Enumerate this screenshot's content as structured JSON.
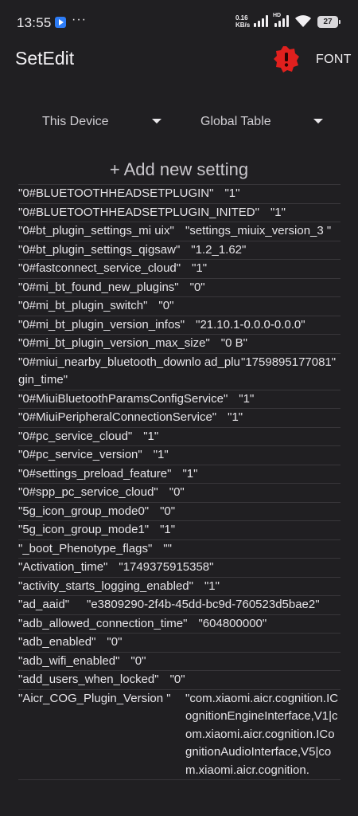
{
  "status_bar": {
    "time": "13:55",
    "more": "···",
    "net_speed_value": "0.16",
    "net_speed_unit": "KB/s",
    "hd": "HD",
    "battery": "27"
  },
  "app_bar": {
    "title": "SetEdit",
    "font_button": "FONT",
    "accent_color": "#e0201e"
  },
  "dropdowns": {
    "device": "This Device",
    "table": "Global Table"
  },
  "add_setting": "+ Add new setting",
  "settings": [
    {
      "key": "\"0#BLUETOOTHHEADSETPLUGIN\"",
      "value": "\"1\""
    },
    {
      "key": "\"0#BLUETOOTHHEADSETPLUGIN_INITED\"",
      "value": "\"1\""
    },
    {
      "key": "\"0#bt_plugin_settings_mi uix\"",
      "value": "\"settings_miuix_version_3 \""
    },
    {
      "key": "\"0#bt_plugin_settings_qigsaw\"",
      "value": "\"1.2_1.62\""
    },
    {
      "key": "\"0#fastconnect_service_cloud\"",
      "value": "\"1\""
    },
    {
      "key": "\"0#mi_bt_found_new_plugins\"",
      "value": "\"0\""
    },
    {
      "key": "\"0#mi_bt_plugin_switch\"",
      "value": "\"0\""
    },
    {
      "key": "\"0#mi_bt_plugin_version_infos\"",
      "value": "\"21.10.1-0.0.0-0.0.0\""
    },
    {
      "key": "\"0#mi_bt_plugin_version_max_size\"",
      "value": "\"0 B\""
    },
    {
      "key": "\"0#miui_nearby_bluetooth_downlo ad_plugin_time\"",
      "value": "\"1759895177081\""
    },
    {
      "key": "\"0#MiuiBluetoothParamsConfigService\"",
      "value": "\"1\""
    },
    {
      "key": "\"0#MiuiPeripheralConnectionService\"",
      "value": "\"1\""
    },
    {
      "key": "\"0#pc_service_cloud\"",
      "value": "\"1\""
    },
    {
      "key": "\"0#pc_service_version\"",
      "value": "\"1\""
    },
    {
      "key": "\"0#settings_preload_feature\"",
      "value": "\"1\""
    },
    {
      "key": "\"0#spp_pc_service_cloud\"",
      "value": "\"0\""
    },
    {
      "key": "\"5g_icon_group_mode0\"",
      "value": "\"0\""
    },
    {
      "key": "\"5g_icon_group_mode1\"",
      "value": "\"1\""
    },
    {
      "key": "\"_boot_Phenotype_flags\"",
      "value": "\"\""
    },
    {
      "key": "\"Activation_time\"",
      "value": "\"1749375915358\""
    },
    {
      "key": "\"activity_starts_logging_enabled\"",
      "value": "\"1\""
    },
    {
      "key": "\"ad_aaid\"",
      "value": "\"e3809290-2f4b-45dd-bc9d-760523d5bae2\""
    },
    {
      "key": "\"adb_allowed_connection_time\"",
      "value": "\"604800000\""
    },
    {
      "key": "\"adb_enabled\"",
      "value": "\"0\""
    },
    {
      "key": "\"adb_wifi_enabled\"",
      "value": "\"0\""
    },
    {
      "key": "\"add_users_when_locked\"",
      "value": "\"0\""
    },
    {
      "key": "\"Aicr_COG_Plugin_Version \"",
      "value": "\"com.xiaomi.aicr.cognition.ICognitionEngineInterface,V1|com.xiaomi.aicr.cognition.ICognitionAudioInterface,V5|com.xiaomi.aicr.cognition."
    }
  ]
}
